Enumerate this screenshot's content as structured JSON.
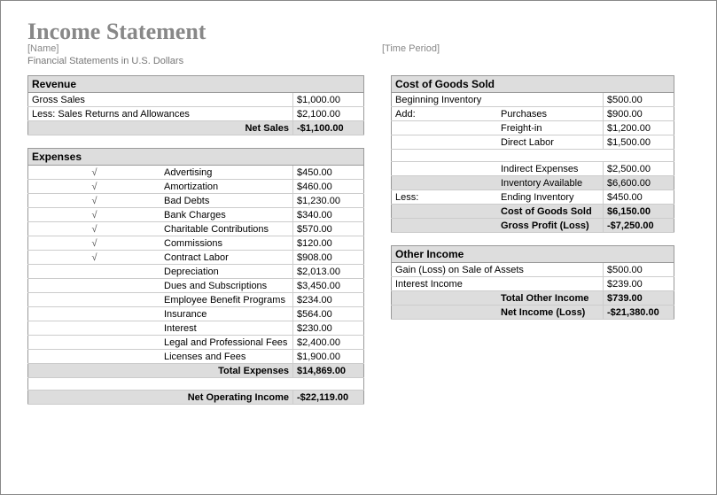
{
  "title": "Income Statement",
  "name_placeholder": "[Name]",
  "period_placeholder": "[Time Period]",
  "subtitle": "Financial Statements in U.S. Dollars",
  "revenue": {
    "header": "Revenue",
    "gross_sales_label": "Gross Sales",
    "gross_sales": "$1,000.00",
    "returns_label": "Less: Sales Returns and Allowances",
    "returns": "$2,100.00",
    "net_sales_label": "Net Sales",
    "net_sales": "-$1,100.00"
  },
  "expenses": {
    "header": "Expenses",
    "items": [
      {
        "check": "√",
        "label": "Advertising",
        "value": "$450.00"
      },
      {
        "check": "√",
        "label": "Amortization",
        "value": "$460.00"
      },
      {
        "check": "√",
        "label": "Bad Debts",
        "value": "$1,230.00"
      },
      {
        "check": "√",
        "label": "Bank Charges",
        "value": "$340.00"
      },
      {
        "check": "√",
        "label": "Charitable Contributions",
        "value": "$570.00"
      },
      {
        "check": "√",
        "label": "Commissions",
        "value": "$120.00"
      },
      {
        "check": "√",
        "label": "Contract Labor",
        "value": "$908.00"
      },
      {
        "check": "",
        "label": "Depreciation",
        "value": "$2,013.00"
      },
      {
        "check": "",
        "label": "Dues and Subscriptions",
        "value": "$3,450.00"
      },
      {
        "check": "",
        "label": "Employee Benefit Programs",
        "value": "$234.00"
      },
      {
        "check": "",
        "label": "Insurance",
        "value": "$564.00"
      },
      {
        "check": "",
        "label": "Interest",
        "value": "$230.00"
      },
      {
        "check": "",
        "label": "Legal and Professional Fees",
        "value": "$2,400.00"
      },
      {
        "check": "",
        "label": "Licenses and Fees",
        "value": "$1,900.00"
      }
    ],
    "total_label": "Total Expenses",
    "total": "$14,869.00",
    "net_op_label": "Net Operating Income",
    "net_op": "-$22,119.00"
  },
  "cogs": {
    "header": "Cost of Goods Sold",
    "begin_label": "Beginning Inventory",
    "begin": "$500.00",
    "add_label": "Add:",
    "purchases_label": "Purchases",
    "purchases": "$900.00",
    "freight_label": "Freight-in",
    "freight": "$1,200.00",
    "direct_labor_label": "Direct Labor",
    "direct_labor": "$1,500.00",
    "indirect_label": "Indirect Expenses",
    "indirect": "$2,500.00",
    "inv_avail_label": "Inventory Available",
    "inv_avail": "$6,600.00",
    "less_label": "Less:",
    "end_inv_label": "Ending Inventory",
    "end_inv": "$450.00",
    "cogs_label": "Cost of Goods Sold",
    "cogs_val": "$6,150.00",
    "gross_profit_label": "Gross Profit (Loss)",
    "gross_profit": "-$7,250.00"
  },
  "other": {
    "header": "Other Income",
    "gain_label": "Gain (Loss) on Sale of Assets",
    "gain": "$500.00",
    "interest_label": "Interest Income",
    "interest": "$239.00",
    "total_label": "Total Other Income",
    "total": "$739.00",
    "net_income_label": "Net Income (Loss)",
    "net_income": "-$21,380.00"
  }
}
